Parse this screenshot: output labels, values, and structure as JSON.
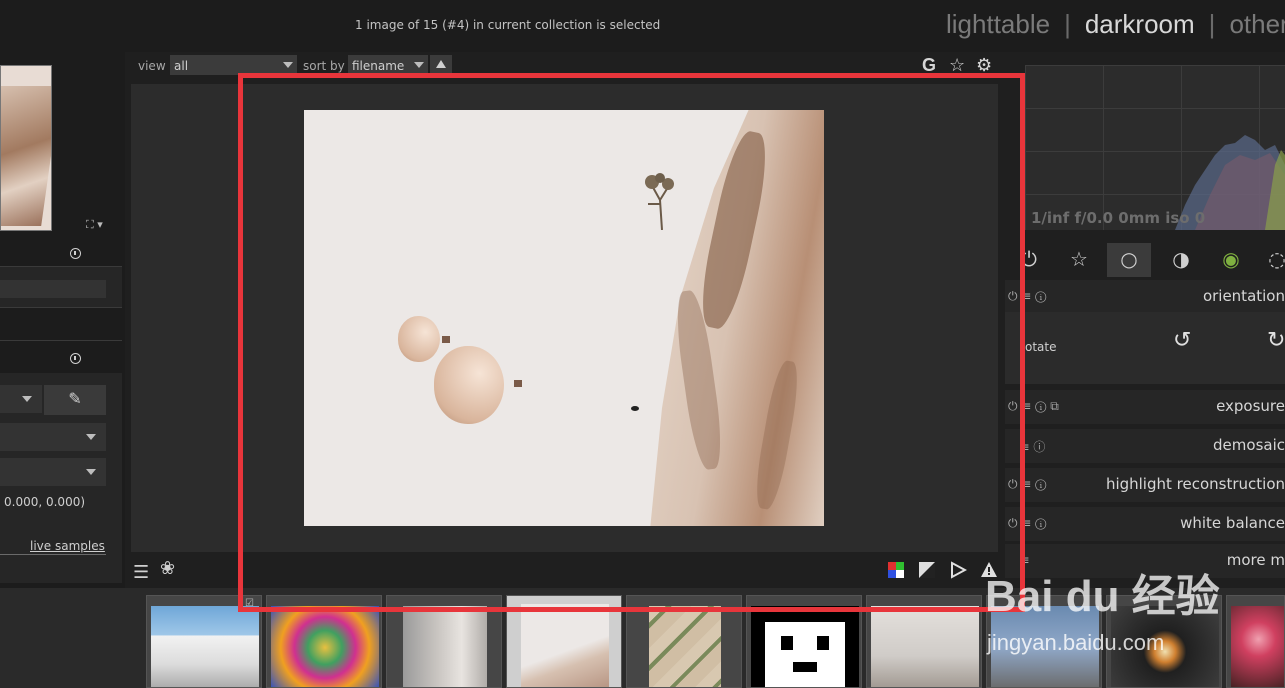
{
  "header": {
    "status": "1 image of 15 (#4) in current collection is selected",
    "views": [
      "lighttable",
      "darkroom",
      "other"
    ],
    "active_view": "darkroom"
  },
  "filter": {
    "view_label": "view",
    "view_value": "all",
    "sort_label": "sort by",
    "sort_value": "filename"
  },
  "left_panel": {
    "coords": "0.000, 0.000)",
    "live_samples": "live samples"
  },
  "right_panel": {
    "histogram_info": "1/inf f/0.0 0mm iso 0",
    "modules": [
      {
        "name": "orientation"
      },
      {
        "name": "exposure"
      },
      {
        "name": "demosaic"
      },
      {
        "name": "highlight reconstruction"
      },
      {
        "name": "white balance"
      },
      {
        "name": "more m"
      }
    ],
    "rotate_label": "otate"
  },
  "filmstrip": {
    "count": 10,
    "active_index": 3
  },
  "watermark": {
    "brand": "Bai  du 经验",
    "url": "jingyan.baidu.com"
  },
  "colors": {
    "highlight": "#e8353b",
    "background": "#1f1f1f",
    "panel": "#2c2c2c"
  }
}
